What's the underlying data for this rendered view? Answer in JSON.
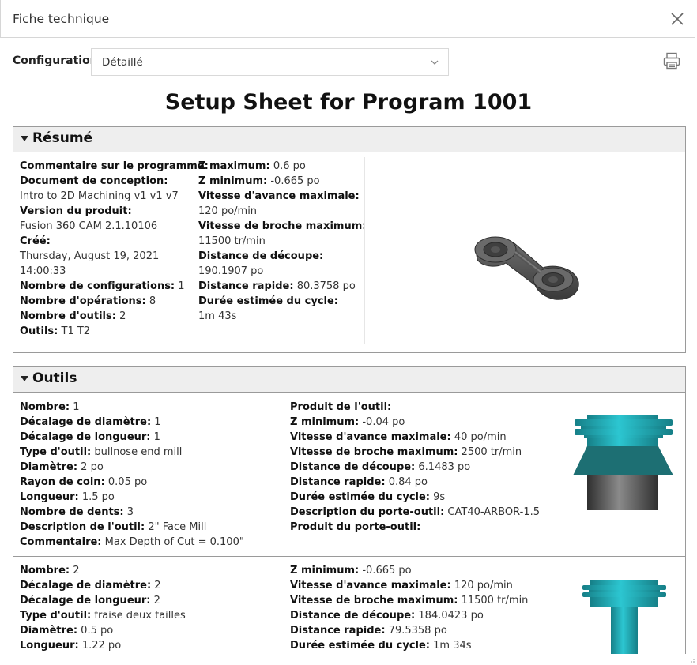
{
  "window": {
    "title": "Fiche technique"
  },
  "config": {
    "label": "Configuration",
    "value": "Détaillé"
  },
  "sheet_title": "Setup Sheet for Program 1001",
  "summary": {
    "header": "Résumé",
    "left": [
      {
        "k": "Commentaire sur le programme:",
        "v": ""
      },
      {
        "k": "Document de conception:",
        "v": ""
      },
      {
        "k": "",
        "v": "Intro to 2D Machining v1 v1 v7"
      },
      {
        "k": "Version du produit:",
        "v": ""
      },
      {
        "k": "",
        "v": "Fusion 360 CAM 2.1.10106"
      },
      {
        "k": "Créé:",
        "v": ""
      },
      {
        "k": "",
        "v": "Thursday, August 19, 2021"
      },
      {
        "k": "",
        "v": "14:00:33"
      },
      {
        "k": "Nombre de configurations:",
        "v": "1"
      },
      {
        "k": "Nombre d'opérations:",
        "v": "8"
      },
      {
        "k": "Nombre d'outils:",
        "v": "2"
      },
      {
        "k": "Outils:",
        "v": "T1 T2"
      }
    ],
    "right": [
      {
        "k": "Z maximum:",
        "v": "0.6 po"
      },
      {
        "k": "Z minimum:",
        "v": "-0.665 po"
      },
      {
        "k": "Vitesse d'avance maximale:",
        "v": ""
      },
      {
        "k": "",
        "v": "120 po/min"
      },
      {
        "k": "Vitesse de broche maximum:",
        "v": ""
      },
      {
        "k": "",
        "v": "11500 tr/min"
      },
      {
        "k": "Distance de découpe:",
        "v": ""
      },
      {
        "k": "",
        "v": "190.1907 po"
      },
      {
        "k": "Distance rapide:",
        "v": "80.3758 po"
      },
      {
        "k": "Durée estimée du cycle:",
        "v": ""
      },
      {
        "k": "",
        "v": "1m 43s"
      }
    ]
  },
  "tools": {
    "header": "Outils",
    "t1": {
      "left": [
        {
          "k": "Nombre:",
          "v": "1"
        },
        {
          "k": "Décalage de diamètre:",
          "v": "1"
        },
        {
          "k": "Décalage de longueur:",
          "v": "1"
        },
        {
          "k": "Type d'outil:",
          "v": "bullnose end mill"
        },
        {
          "k": "Diamètre:",
          "v": "2 po"
        },
        {
          "k": "Rayon de coin:",
          "v": "0.05 po"
        },
        {
          "k": "Longueur:",
          "v": "1.5 po"
        },
        {
          "k": "Nombre de dents:",
          "v": "3"
        },
        {
          "k": "Description de l'outil:",
          "v": "2\" Face Mill"
        },
        {
          "k": "Commentaire:",
          "v": "Max Depth of Cut = 0.100\""
        }
      ],
      "right": [
        {
          "k": "Produit de l'outil:",
          "v": ""
        },
        {
          "k": "Z minimum:",
          "v": "-0.04 po"
        },
        {
          "k": "Vitesse d'avance maximale:",
          "v": "40 po/min"
        },
        {
          "k": "Vitesse de broche maximum:",
          "v": "2500 tr/min"
        },
        {
          "k": "Distance de découpe:",
          "v": "6.1483 po"
        },
        {
          "k": "Distance rapide:",
          "v": "0.84 po"
        },
        {
          "k": "Durée estimée du cycle:",
          "v": "9s"
        },
        {
          "k": "Description du porte-outil:",
          "v": "CAT40-ARBOR-1.5"
        },
        {
          "k": "Produit du porte-outil:",
          "v": ""
        }
      ]
    },
    "t2": {
      "left": [
        {
          "k": "Nombre:",
          "v": "2"
        },
        {
          "k": "Décalage de diamètre:",
          "v": "2"
        },
        {
          "k": "Décalage de longueur:",
          "v": "2"
        },
        {
          "k": "Type d'outil:",
          "v": "fraise deux tailles"
        },
        {
          "k": "Diamètre:",
          "v": "0.5 po"
        },
        {
          "k": "Longueur:",
          "v": "1.22 po"
        }
      ],
      "right": [
        {
          "k": "Z minimum:",
          "v": "-0.665 po"
        },
        {
          "k": "Vitesse d'avance maximale:",
          "v": "120 po/min"
        },
        {
          "k": "Vitesse de broche maximum:",
          "v": "11500 tr/min"
        },
        {
          "k": "Distance de découpe:",
          "v": "184.0423 po"
        },
        {
          "k": "Distance rapide:",
          "v": "79.5358 po"
        },
        {
          "k": "Durée estimée du cycle:",
          "v": "1m 34s"
        }
      ]
    }
  },
  "colors": {
    "tool_teal": "#1aa8b4",
    "tool_dark_teal": "#1d6f73",
    "holder_gray": "#5a5a5a"
  },
  "icons": {
    "close": "close-icon",
    "chevron": "chevron-down-icon",
    "print": "print-icon"
  }
}
